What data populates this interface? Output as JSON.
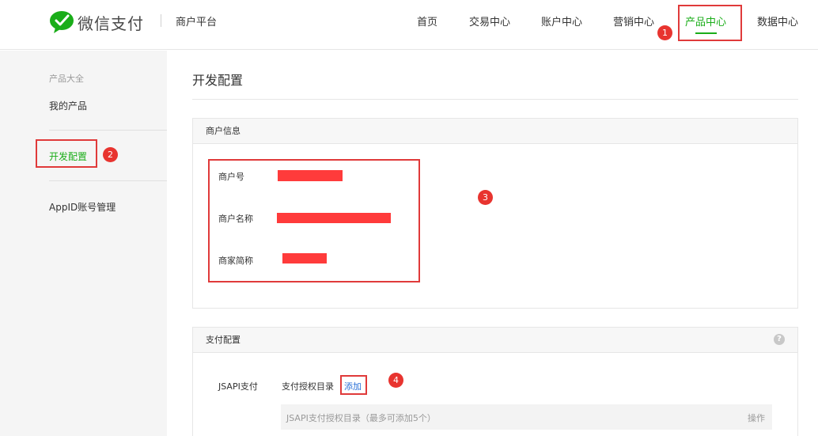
{
  "header": {
    "logo_text": "微信支付",
    "platform": "商户平台",
    "nav": [
      {
        "label": "首页"
      },
      {
        "label": "交易中心"
      },
      {
        "label": "账户中心"
      },
      {
        "label": "营销中心"
      },
      {
        "label": "产品中心",
        "active": true
      },
      {
        "label": "数据中心"
      }
    ]
  },
  "sidebar": {
    "group_title": "产品大全",
    "items": [
      {
        "label": "我的产品"
      },
      {
        "label": "开发配置",
        "active": true
      },
      {
        "label": "AppID账号管理"
      }
    ]
  },
  "main": {
    "title": "开发配置",
    "merchant_panel": {
      "title": "商户信息",
      "fields": [
        {
          "label": "商户号"
        },
        {
          "label": "商户名称"
        },
        {
          "label": "商家简称"
        }
      ]
    },
    "pay_panel": {
      "title": "支付配置",
      "help_icon": "question-icon",
      "jsapi_label": "JSAPI支付",
      "auth_dir_label": "支付授权目录",
      "add_link": "添加",
      "table_header": {
        "col1": "JSAPI支付授权目录（最多可添加5个）",
        "col2": "操作"
      }
    }
  },
  "annotations": [
    "1",
    "2",
    "3",
    "4"
  ],
  "colors": {
    "accent": "#1aad19",
    "highlight": "#e03a3a",
    "badge": "#e8342f",
    "redaction": "#ff3b3b",
    "link": "#2a6fd6"
  }
}
